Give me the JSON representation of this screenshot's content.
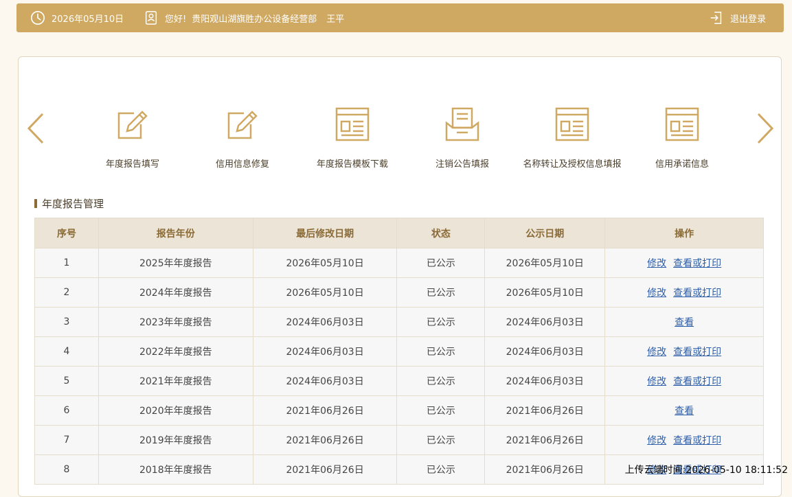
{
  "header": {
    "date": "2026年05月10日",
    "greeting": "您好!",
    "org_name": "贵阳观山湖旗胜办公设备经营部",
    "user_name": "王平",
    "logout_label": "退出登录"
  },
  "nav": {
    "prev_icon": "chevron-left-icon",
    "next_icon": "chevron-right-icon",
    "tiles": [
      {
        "label": "年度报告填写",
        "icon": "edit-form-icon"
      },
      {
        "label": "信用信息修复",
        "icon": "edit-form-icon"
      },
      {
        "label": "年度报告模板下载",
        "icon": "document-list-icon"
      },
      {
        "label": "注销公告填报",
        "icon": "inbox-document-icon"
      },
      {
        "label": "名称转让及授权信息填报",
        "icon": "document-list-icon"
      },
      {
        "label": "信用承诺信息",
        "icon": "document-list-icon"
      }
    ]
  },
  "section": {
    "title": "年度报告管理"
  },
  "table": {
    "headers": [
      "序号",
      "报告年份",
      "最后修改日期",
      "状态",
      "公示日期",
      "操作"
    ],
    "rows": [
      {
        "no": "1",
        "year": "2025年年度报告",
        "modified": "2026年05月10日",
        "status": "已公示",
        "published": "2026年05月10日",
        "actions": [
          "修改",
          "查看或打印"
        ]
      },
      {
        "no": "2",
        "year": "2024年年度报告",
        "modified": "2026年05月10日",
        "status": "已公示",
        "published": "2026年05月10日",
        "actions": [
          "修改",
          "查看或打印"
        ]
      },
      {
        "no": "3",
        "year": "2023年年度报告",
        "modified": "2024年06月03日",
        "status": "已公示",
        "published": "2024年06月03日",
        "actions": [
          "查看"
        ]
      },
      {
        "no": "4",
        "year": "2022年年度报告",
        "modified": "2024年06月03日",
        "status": "已公示",
        "published": "2024年06月03日",
        "actions": [
          "修改",
          "查看或打印"
        ]
      },
      {
        "no": "5",
        "year": "2021年年度报告",
        "modified": "2024年06月03日",
        "status": "已公示",
        "published": "2024年06月03日",
        "actions": [
          "修改",
          "查看或打印"
        ]
      },
      {
        "no": "6",
        "year": "2020年年度报告",
        "modified": "2021年06月26日",
        "status": "已公示",
        "published": "2021年06月26日",
        "actions": [
          "查看"
        ]
      },
      {
        "no": "7",
        "year": "2019年年度报告",
        "modified": "2021年06月26日",
        "status": "已公示",
        "published": "2021年06月26日",
        "actions": [
          "修改",
          "查看或打印"
        ]
      },
      {
        "no": "8",
        "year": "2018年年度报告",
        "modified": "2021年06月26日",
        "status": "已公示",
        "published": "2021年06月26日",
        "actions": [
          "修改",
          "查看或打印"
        ]
      }
    ]
  },
  "watermark": "上传云端时间:2026-05-10 18:11:52",
  "colors": {
    "accent": "#cfa862",
    "header_row": "#ece4d6",
    "link": "#2f5fa8"
  }
}
